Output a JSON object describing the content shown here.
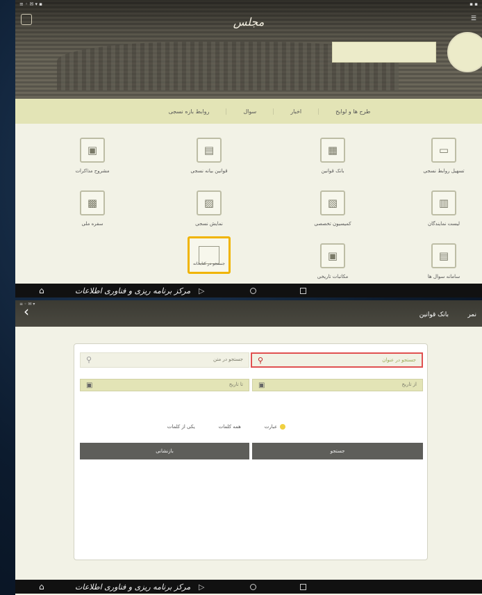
{
  "top": {
    "status_left": "≡ ◦ ✉ ▾ ▪",
    "status_right": "▪ ▪",
    "logo_text": "مجلس",
    "tabs": [
      "طرح ها و لوایح",
      "اخبار",
      "سوال",
      "روابط بازه نسجی"
    ],
    "tiles": [
      {
        "label": "تسهیل روابط نسجی",
        "icon": "▭"
      },
      {
        "label": "بانک قوانین",
        "icon": "▦"
      },
      {
        "label": "قوانین بیانه نسجی",
        "icon": "▤"
      },
      {
        "label": "مشروح مذاکرات",
        "icon": "▣"
      },
      {
        "label": "لیست نمایندگان",
        "icon": "▥"
      },
      {
        "label": "کمیسیون تخصصی",
        "icon": "▧"
      },
      {
        "label": "نمایش نسجی",
        "icon": "▨"
      },
      {
        "label": "سفره ملی",
        "icon": "▩"
      },
      {
        "label": "سامانه سوال ها",
        "icon": "▤"
      },
      {
        "label": "مکاتبات تاریخی",
        "icon": "▣"
      },
      {
        "label": "جستجو در کتابخانه",
        "icon": "▭"
      }
    ]
  },
  "nav": {
    "signature": "مرکز برنامه ریزی و فناوری اطلاعات",
    "home": "⌂",
    "back": "▷",
    "circle": "",
    "square": ""
  },
  "bottom": {
    "status": "≡ ◦ ✉ ▾",
    "back_symbol": "‹",
    "title": "بانک قوانین",
    "menu": "نمر",
    "search_title_placeholder": "جستجو در عنوان",
    "search_text_placeholder": "جستجو در متن",
    "date_from": "از تاریخ",
    "date_to": "تا تاریخ",
    "radio_exact": "عبارت",
    "radio_all": "همه کلمات",
    "radio_any": "یکی از کلمات",
    "btn_search": "جستجو",
    "btn_reset": "بازنشانی"
  }
}
